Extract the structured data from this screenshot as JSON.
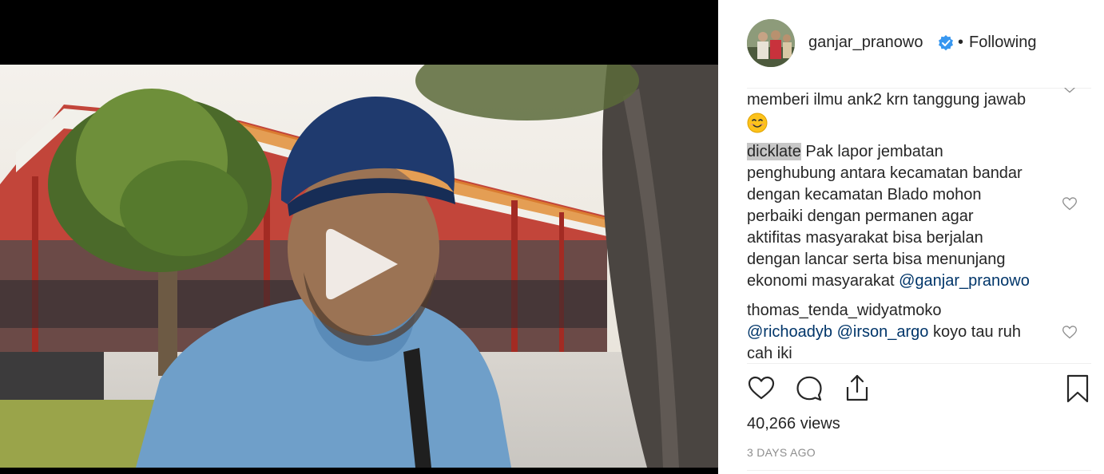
{
  "post": {
    "username": "ganjar_pranowo",
    "separator": "•",
    "follow_status": "Following",
    "views": "40,266 views",
    "timestamp": "3 DAYS AGO"
  },
  "comments": [
    {
      "text": "memberi ilmu ank2 krn tanggung jawab",
      "emoji": "😊"
    },
    {
      "user": "dicklate",
      "lines": [
        "Pak lapor jembatan",
        "penghubung antara kecamatan bandar",
        "dengan kecamatan Blado mohon",
        "perbaiki dengan permanen agar",
        "aktifitas masyarakat bisa berjalan",
        "dengan lancar serta bisa menunjang"
      ],
      "last_line_text": "ekonomi masyarakat",
      "mention": "@ganjar_pranowo"
    },
    {
      "user": "thomas_tenda_widyatmoko",
      "mention1": "@richoadyb",
      "mention2": "@irson_argo",
      "text_after": "koyo tau ruh",
      "text_line2": "cah iki"
    }
  ],
  "icons": {
    "play": "play-icon",
    "verified": "verified-badge-icon",
    "like": "heart-icon",
    "comment": "comment-bubble-icon",
    "share": "share-icon",
    "save": "bookmark-icon"
  },
  "colors": {
    "mention": "#003569",
    "verified": "#3897f0",
    "muted": "#8e8e8e"
  }
}
